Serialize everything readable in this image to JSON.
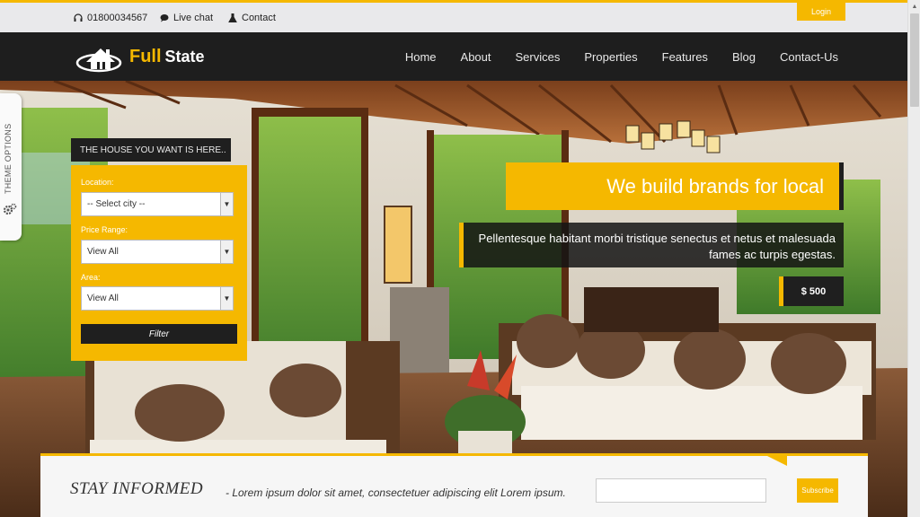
{
  "topbar": {
    "phone": "01800034567",
    "chat": "Live chat",
    "contact": "Contact",
    "login": "Login"
  },
  "logo": {
    "full": "Full",
    "state": "State"
  },
  "nav": [
    "Home",
    "About",
    "Services",
    "Properties",
    "Features",
    "Blog",
    "Contact-Us"
  ],
  "theme_options": "THEME OPTIONS",
  "search": {
    "heading": "THE HOUSE YOU WANT IS HERE..",
    "location_label": "Location:",
    "location_value": "-- Select city --",
    "price_label": "Price Range:",
    "price_value": "View All",
    "area_label": "Area:",
    "area_value": "View All",
    "filter": "Filter"
  },
  "hero": {
    "headline": "We build brands for local",
    "subtext": "Pellentesque habitant morbi tristique senectus et netus et malesuada fames ac turpis egestas.",
    "price": "$ 500"
  },
  "newsletter": {
    "title": "STAY INFORMED",
    "text": "- Lorem ipsum dolor sit amet, consectetuer adipiscing elit Lorem ipsum.",
    "subscribe": "Subscribe"
  },
  "colors": {
    "accent": "#f5b800",
    "dark": "#1e1e1e"
  }
}
